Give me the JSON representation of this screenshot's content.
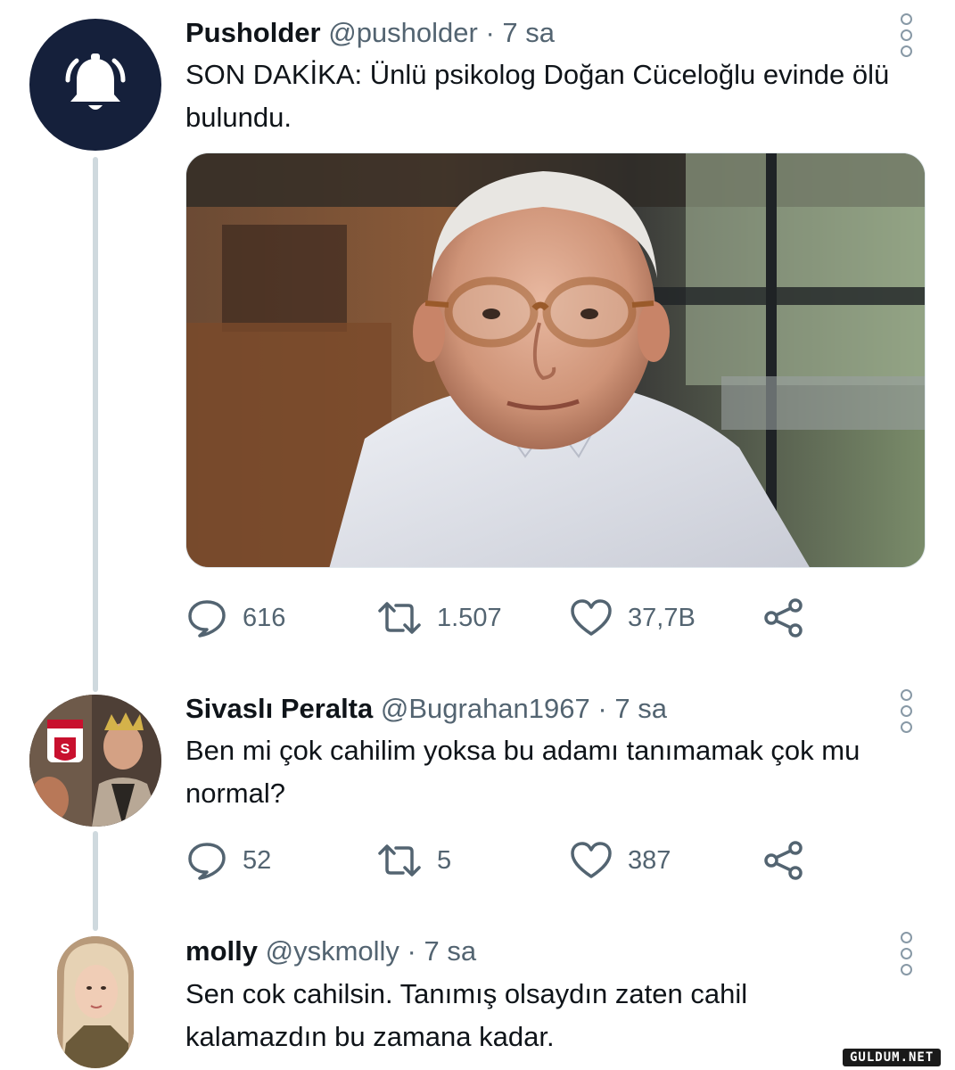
{
  "tweets": [
    {
      "name": "Pusholder",
      "handle": "@pusholder",
      "separator": "·",
      "time": "7 sa",
      "text": "SON DAKİKA: Ünlü psikolog Doğan Cüceloğlu evinde ölü bulundu.",
      "avatar_icon": "bell-icon",
      "has_media": true,
      "stats": {
        "replies": "616",
        "retweets": "1.507",
        "likes": "37,7B"
      }
    },
    {
      "name": "Sivaslı Peralta",
      "handle": "@Bugrahan1967",
      "separator": "·",
      "time": "7 sa",
      "text": "Ben mi çok cahilim yoksa bu adamı tanımamak çok mu normal?",
      "stats": {
        "replies": "52",
        "retweets": "5",
        "likes": "387"
      }
    },
    {
      "name": "molly",
      "handle": "@yskmolly",
      "separator": "·",
      "time": "7 sa",
      "text": "Sen cok cahilsin. Tanımış olsaydın zaten cahil kalamazdın bu zamana kadar."
    }
  ],
  "icons": [
    "reply-icon",
    "retweet-icon",
    "like-icon",
    "share-icon",
    "more-icon"
  ],
  "colors": {
    "text": "#0f1419",
    "muted": "#536471",
    "thread_line": "#cfd9de",
    "bell_avatar_bg": "#15203b"
  },
  "watermark": "GULDUM.NET"
}
